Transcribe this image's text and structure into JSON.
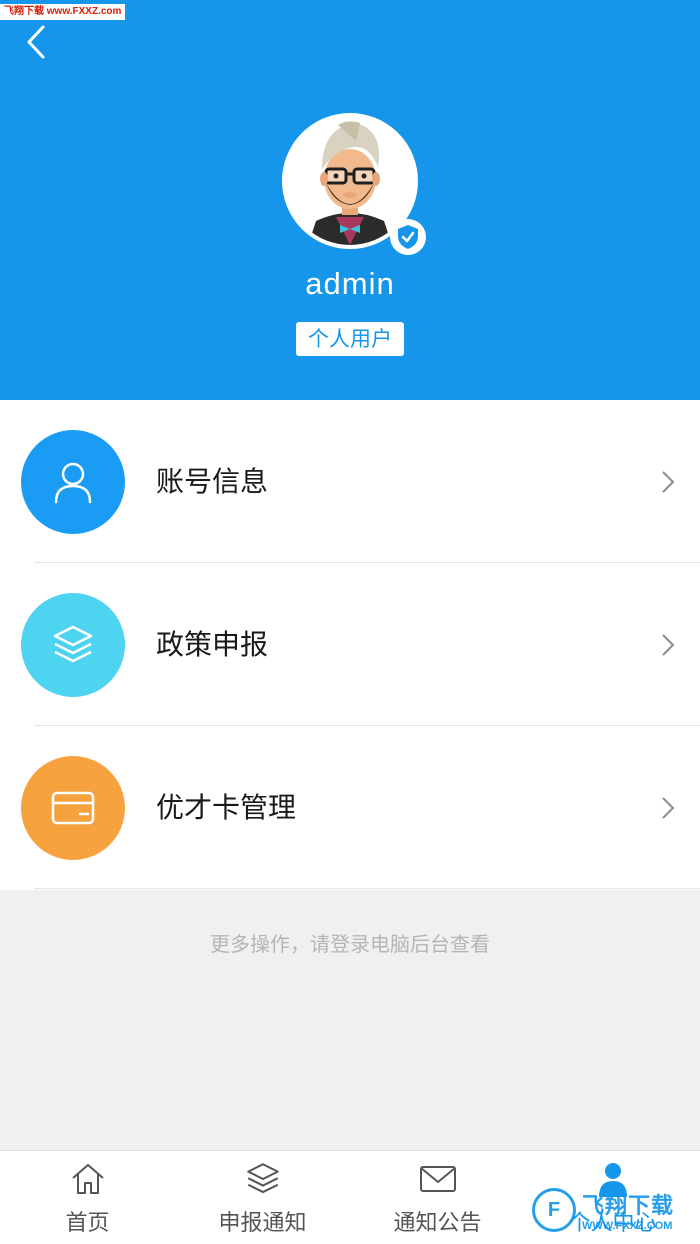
{
  "watermark_top": "飞翔下载 www.FXXZ.com",
  "header": {
    "username": "admin",
    "role": "个人用户",
    "colors": {
      "background": "#1596ea"
    }
  },
  "menu": {
    "items": [
      {
        "label": "账号信息",
        "icon": "user-icon",
        "color": "#1a9cf5"
      },
      {
        "label": "政策申报",
        "icon": "layers-icon",
        "color": "#4ed4f0"
      },
      {
        "label": "优才卡管理",
        "icon": "card-icon",
        "color": "#f5a23f"
      }
    ]
  },
  "hint": "更多操作，请登录电脑后台查看",
  "tabbar": {
    "tabs": [
      {
        "label": "首页",
        "icon": "home-icon"
      },
      {
        "label": "申报通知",
        "icon": "layers-icon"
      },
      {
        "label": "通知公告",
        "icon": "mail-icon"
      },
      {
        "label": "个人中心",
        "icon": "person-icon",
        "active": true
      }
    ]
  },
  "watermark_bottom": {
    "name": "飞翔下载",
    "url": "WWW.FXXZ.COM",
    "logo": "F"
  }
}
